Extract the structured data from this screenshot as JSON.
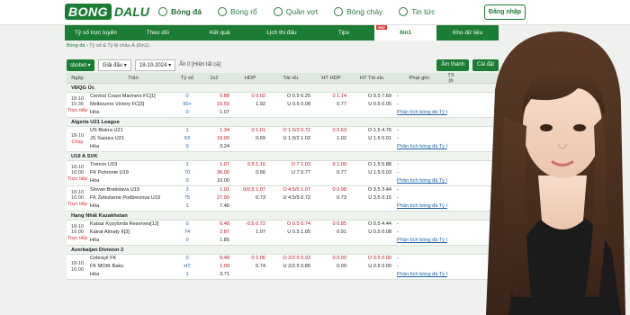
{
  "brand": {
    "part1": "BONG",
    "part2": "DALU"
  },
  "mainnav": [
    {
      "label": "Bóng đá",
      "icon": "soccer-ball-icon",
      "active": true
    },
    {
      "label": "Bóng rổ",
      "icon": "basketball-icon"
    },
    {
      "label": "Quần vợt",
      "icon": "tennis-icon"
    },
    {
      "label": "Bóng chày",
      "icon": "baseball-icon"
    },
    {
      "label": "Tin tức",
      "icon": "news-icon"
    }
  ],
  "login_label": "Đăng nhập",
  "subnav": [
    {
      "label": "Tỷ số trực tuyến"
    },
    {
      "label": "Theo dõi"
    },
    {
      "label": "Kết quả"
    },
    {
      "label": "Lịch thi đấu"
    },
    {
      "label": "Tips"
    },
    {
      "label": "6in1",
      "active": true,
      "badge": "Hot"
    },
    {
      "label": "Kho dữ liệu"
    }
  ],
  "breadcrumb": {
    "home": "Bóng đá",
    "rest": " › Tỷ số & Tỷ lệ châu Á  (6in1)"
  },
  "toolbar": {
    "bookmaker": "sbobet ▾",
    "league_select": "Giải đấu ▾",
    "date": "18-10-2024 ▾",
    "hidden": "Ẩn 0  [Hiện tất cả]",
    "sound": "Âm thanh",
    "settings": "Cài đặt"
  },
  "headers": [
    "Ngày",
    "Trận",
    "Tỷ số",
    "1x2",
    "HDP",
    "Tài xỉu",
    "HT HDP",
    "HT Tài xỉu",
    "Phạt góc",
    "TS (b"
  ],
  "leagues": [
    {
      "name": "VĐQG Úc",
      "matches": [
        {
          "date": "18-10",
          "time": "15:35",
          "status": "Trực tiếp",
          "home": "Central Coast Mariners FC[1]",
          "away": "Melbourne Victory FC[3]",
          "draw": "Hòa",
          "score": [
            "0",
            "90+",
            "0"
          ],
          "x12": [
            "9.88",
            "15.50",
            "1.07"
          ],
          "hdp": [
            "0  0.02",
            "1.92",
            ""
          ],
          "tx": [
            "O 0.5  6.25",
            "U 0.5  0.08",
            ""
          ],
          "hthdp": [
            "0  1.14",
            "0.77",
            ""
          ],
          "httx": [
            "O 0.5  7.69",
            "U 0.5  0.05",
            ""
          ],
          "corner": [
            "-",
            "-",
            "Phân tích bóng đá Tỷ l"
          ]
        }
      ]
    },
    {
      "name": "Algeria U21 League",
      "matches": [
        {
          "date": "18-10",
          "time": "",
          "status": "Chạy",
          "home": "US Biskra U21",
          "away": "JS Saoura U21",
          "draw": "Hòa",
          "score": [
            "1",
            "63",
            "0"
          ],
          "x12": [
            "1.34",
            "16.00",
            "3.24"
          ],
          "hdp": [
            "0  1.01",
            "0.69",
            ""
          ],
          "tx": [
            "O 1.5/2  0.72",
            "U 1.5/2  1.02",
            ""
          ],
          "hthdp": [
            "0  0.63",
            "1.02",
            ""
          ],
          "httx": [
            "O 1.5  4.76",
            "U 1.5  0.01",
            ""
          ],
          "corner": [
            "-",
            "-",
            "Phân tích bóng đá Tỷ l"
          ]
        }
      ]
    },
    {
      "name": "U19 A SVK",
      "matches": [
        {
          "date": "18-10",
          "time": "16:00",
          "status": "Trực tiếp",
          "home": "Trencin U19",
          "away": "FK Pohronie U19",
          "draw": "Hòa",
          "score": [
            "1",
            "70",
            "0"
          ],
          "x12": [
            "1.07",
            "36.00",
            "10.00"
          ],
          "hdp": [
            "0.5  1.16",
            "0.66",
            ""
          ],
          "tx": [
            "O 7  1.03",
            "U 7  0.77",
            ""
          ],
          "hthdp": [
            "0  1.00",
            "0.77",
            ""
          ],
          "httx": [
            "O 1.5  5.88",
            "U 1.5  0.03",
            ""
          ],
          "corner": [
            "-",
            "-",
            "Phân tích bóng đá Tỷ l"
          ]
        },
        {
          "date": "18-10",
          "time": "16:00",
          "status": "Trực tiếp",
          "home": "Slovan Bratislava U19",
          "away": "FK Zeleziarne Podbrezova U19",
          "draw": "Hòa",
          "score": [
            "3",
            "75",
            "1"
          ],
          "x12": [
            "1.01",
            "27.00",
            "7.46"
          ],
          "hdp": [
            "0/0.5  1.07",
            "0.73",
            ""
          ],
          "tx": [
            "O 4.5/5  1.07",
            "U 4.5/5  0.72",
            ""
          ],
          "hthdp": [
            "0  0.98",
            "0.73",
            ""
          ],
          "httx": [
            "O 3.5  3.44",
            "U 3.5  0.15",
            ""
          ],
          "corner": [
            "-",
            "-",
            "Phân tích bóng đá Tỷ l"
          ]
        }
      ]
    },
    {
      "name": "Hạng Nhất Kazakhstan",
      "matches": [
        {
          "date": "18-10",
          "time": "16:00",
          "status": "Trực tiếp",
          "home": "Kaisar Kyzylorda Reserves[12]",
          "away": "Kairat Almaty II[3]",
          "draw": "Hòa",
          "score": [
            "0",
            "74",
            "0"
          ],
          "x12": [
            "6.48",
            "2.87",
            "1.85"
          ],
          "hdp": [
            "-0.5  0.72",
            "1.07",
            ""
          ],
          "tx": [
            "O 0.5  0.74",
            "U 0.5  1.05",
            ""
          ],
          "hthdp": [
            "0  0.85",
            "0.91",
            ""
          ],
          "httx": [
            "O 0.5  4.44",
            "U 0.5  0.08",
            ""
          ],
          "corner": [
            "-",
            "-",
            "Phân tích bóng đá Tỷ l"
          ]
        }
      ]
    },
    {
      "name": "Azerbaijan Division 2",
      "matches": [
        {
          "date": "18-10",
          "time": "16:00",
          "status": "",
          "home": "Cebrayil FK",
          "away": "FK MOIK Baku",
          "draw": "Hòa",
          "score": [
            "0",
            "HT",
            "1"
          ],
          "x12": [
            "9.48",
            "1.09",
            "3.71"
          ],
          "hdp": [
            "0  1.06",
            "0.74",
            ""
          ],
          "tx": [
            "O 2/2.5  0.93",
            "U 2/2.5  0.86",
            ""
          ],
          "hthdp": [
            "0  0.00",
            "0.00",
            ""
          ],
          "httx": [
            "O 0.5  0.00",
            "U 0.5  0.00",
            ""
          ],
          "corner": [
            "-",
            "-",
            "Phân tích bóng đá Tỷ l"
          ]
        }
      ]
    }
  ],
  "colors": {
    "brand_green": "#1a7d33",
    "odds_red": "#c0111b",
    "highlight": "#f4e37c"
  }
}
